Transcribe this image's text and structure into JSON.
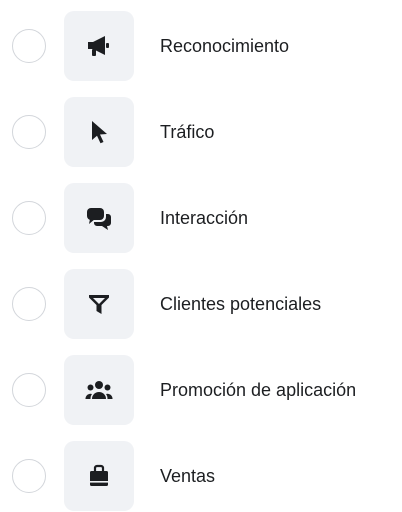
{
  "objectives": [
    {
      "label": "Reconocimiento",
      "icon": "megaphone-icon",
      "selected": false
    },
    {
      "label": "Tráfico",
      "icon": "cursor-icon",
      "selected": false
    },
    {
      "label": "Interacción",
      "icon": "chat-bubbles-icon",
      "selected": false
    },
    {
      "label": "Clientes potenciales",
      "icon": "funnel-icon",
      "selected": false
    },
    {
      "label": "Promoción de aplicación",
      "icon": "people-group-icon",
      "selected": false
    },
    {
      "label": "Ventas",
      "icon": "shopping-bag-icon",
      "selected": false
    }
  ],
  "colors": {
    "icon": "#1c1e21",
    "tile": "#f0f2f5",
    "radio_border": "#d3d6db",
    "text": "#1c1e21"
  }
}
